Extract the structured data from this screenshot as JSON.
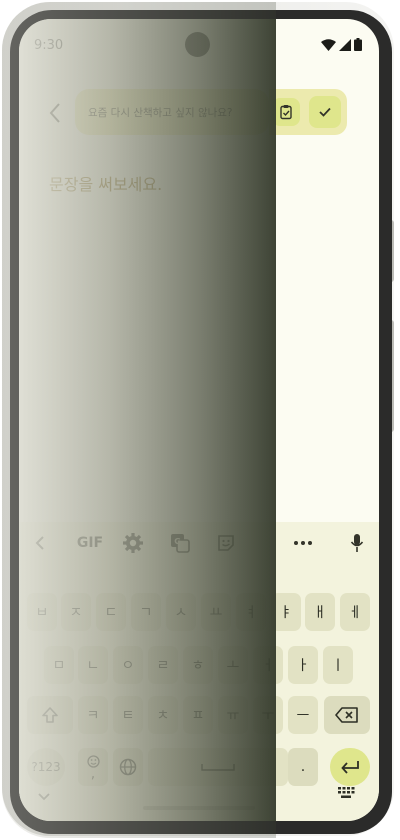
{
  "status": {
    "time": "9:30"
  },
  "header": {
    "prompt": "요즘 다시 산책하고 싶지 않나요?",
    "back_icon": "chevron-left-icon",
    "doc_icon": "clipboard-check-icon",
    "confirm_icon": "check-icon"
  },
  "editor": {
    "placeholder": "문장을 써보세요."
  },
  "keyboard": {
    "toolbar": {
      "gif": "GIF"
    },
    "row1": [
      "ㅂ",
      "ㅈ",
      "ㄷ",
      "ㄱ",
      "ㅅ",
      "ㅛ",
      "ㅕ",
      "ㅑ",
      "ㅐ",
      "ㅔ"
    ],
    "row2": [
      "ㅁ",
      "ㄴ",
      "ㅇ",
      "ㄹ",
      "ㅎ",
      "ㅗ",
      "ㅓ",
      "ㅏ",
      "ㅣ"
    ],
    "row3": [
      "ㅋ",
      "ㅌ",
      "ㅊ",
      "ㅍ",
      "ㅠ",
      "ㅜ",
      "ㅡ"
    ],
    "row4": {
      "symbols": "?123",
      "emoji_comma": ",",
      "period": "."
    }
  },
  "colors": {
    "screen_bg": "#fcfcf2",
    "chip_bg": "#eceaae",
    "accent": "#dfe68c",
    "placeholder": "#8a6c1c"
  }
}
